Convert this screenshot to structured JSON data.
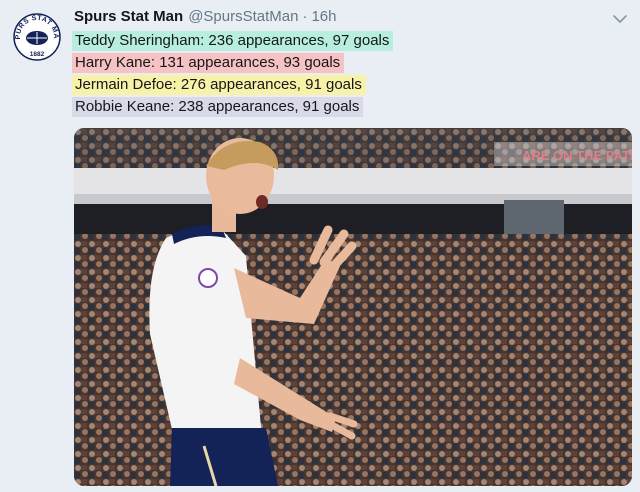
{
  "tweet": {
    "author": {
      "display_name": "Spurs Stat Man",
      "handle": "@SpursStatMan",
      "avatar_icon": "spurs-stat-man-logo-icon",
      "avatar_text_top": "SPURS STAT MAN",
      "avatar_text_bottom": "1882"
    },
    "separator": "·",
    "timestamp": "16h",
    "menu_icon": "chevron-down-icon",
    "lines": [
      {
        "text": "Teddy Sheringham: 236 appearances, 97 goals",
        "highlight": "#b8eee0"
      },
      {
        "text": "Harry Kane: 131 appearances, 93 goals",
        "highlight": "#f6c2c4"
      },
      {
        "text": "Jermain Defoe: 276 appearances, 91 goals",
        "highlight": "#f7f2a8"
      },
      {
        "text": "Robbie Keane: 238 appearances, 91 goals",
        "highlight": "#d9d9e8"
      }
    ],
    "media": {
      "icon": "football-celebration-photo",
      "stadium_banner_text": "ARE ON THE PATH"
    }
  },
  "colors": {
    "background": "#e8eef3",
    "name": "#14171a",
    "meta": "#657786",
    "spurs_navy": "#132257"
  }
}
